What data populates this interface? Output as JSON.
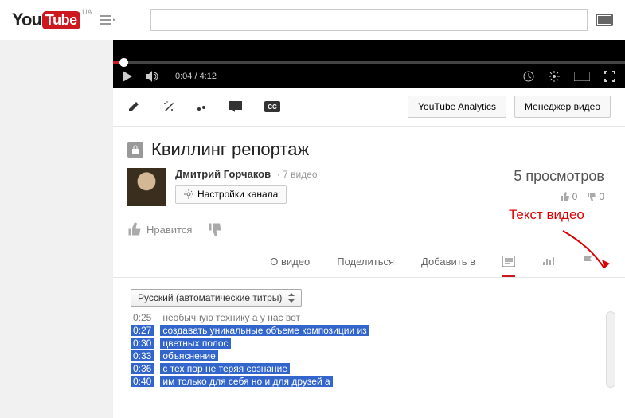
{
  "header": {
    "logo_you": "You",
    "logo_tube": "Tube",
    "region": "UA",
    "search_placeholder": ""
  },
  "player": {
    "current_time": "0:04",
    "duration": "4:12"
  },
  "action_bar": {
    "analytics": "YouTube Analytics",
    "manager": "Менеджер видео"
  },
  "video": {
    "title": "Квиллинг репортаж"
  },
  "channel": {
    "name": "Дмитрий Горчаков",
    "video_count": "7 видео",
    "settings_label": "Настройки канала"
  },
  "stats": {
    "views": "5 просмотров",
    "likes": "0",
    "dislikes": "0"
  },
  "engage": {
    "like_label": "Нравится"
  },
  "tabs": {
    "about": "О видео",
    "share": "Поделиться",
    "add_to": "Добавить в"
  },
  "annotation": "Текст видео",
  "transcript": {
    "language": "Русский (автоматические титры)",
    "lines": [
      {
        "time": "0:25",
        "text": "необычную технику а у нас вот"
      },
      {
        "time": "0:27",
        "text": "создавать уникальные объеме композиции из"
      },
      {
        "time": "0:30",
        "text": "цветных полос"
      },
      {
        "time": "0:33",
        "text": "объяснение"
      },
      {
        "time": "0:36",
        "text": "с тех пор не теряя сознание"
      },
      {
        "time": "0:40",
        "text": "им только для себя но и для друзей а"
      }
    ]
  }
}
